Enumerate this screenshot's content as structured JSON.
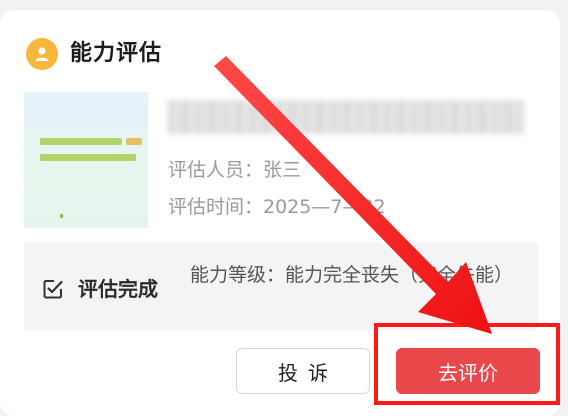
{
  "card": {
    "title": "能力评估",
    "assessor": "评估人员：张三",
    "assess_time": "评估时间：2025—7—22"
  },
  "thumbnail": {
    "description_lines": [
      "用心工作 关爱老人 温暖晚年",
      "服务社会 温暖你我 幸福家园"
    ]
  },
  "status": {
    "label": "评估完成",
    "level_text": "能力等级：能力完全丧失（完全失能）"
  },
  "actions": {
    "complain_label": "投诉",
    "evaluate_label": "去评价"
  },
  "colors": {
    "primary": "#e9474a",
    "accent_icon": "#f6b73c",
    "annotation": "#ff1a1a"
  },
  "icons": {
    "header": "user-badge-icon",
    "status": "checkbox-edit-icon",
    "annotation": "arrow-icon"
  }
}
